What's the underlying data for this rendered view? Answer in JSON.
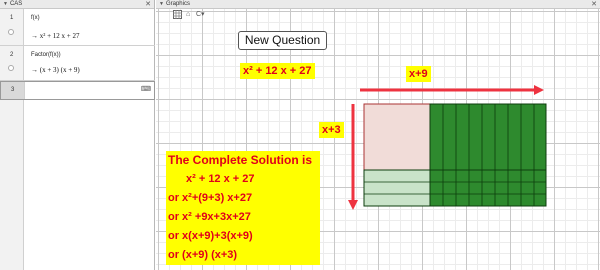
{
  "cas": {
    "title": "CAS",
    "rows": [
      {
        "num": "1",
        "input": "f(x)",
        "output": "→  x² + 12 x + 27"
      },
      {
        "num": "2",
        "input": "Factor(f(x))",
        "output": "→  (x + 3) (x + 9)"
      },
      {
        "num": "3",
        "input": "",
        "output": ""
      }
    ],
    "row_menu_icon": "keyboard-icon"
  },
  "graphics": {
    "title": "Graphics",
    "new_question_label": "New Question",
    "expression": "x² + 12 x + 27",
    "top_label": "x+9",
    "side_label": "x+3",
    "solution": {
      "heading": "The Complete Solution is",
      "lines": [
        "x² + 12 x + 27",
        "or  x²+(9+3) x+27",
        "or  x² +9x+3x+27",
        "or  x(x+9)+3(x+9)",
        "or  (x+9) (x+3)"
      ]
    },
    "colors": {
      "arrow": "#ee3340",
      "dark_green": "#2e8a2e",
      "light_green": "#c9e3c9",
      "pink": "#f1dcd8",
      "square_border": "#a33",
      "highlight": "#ffff00",
      "text_red": "#e0001a"
    }
  }
}
